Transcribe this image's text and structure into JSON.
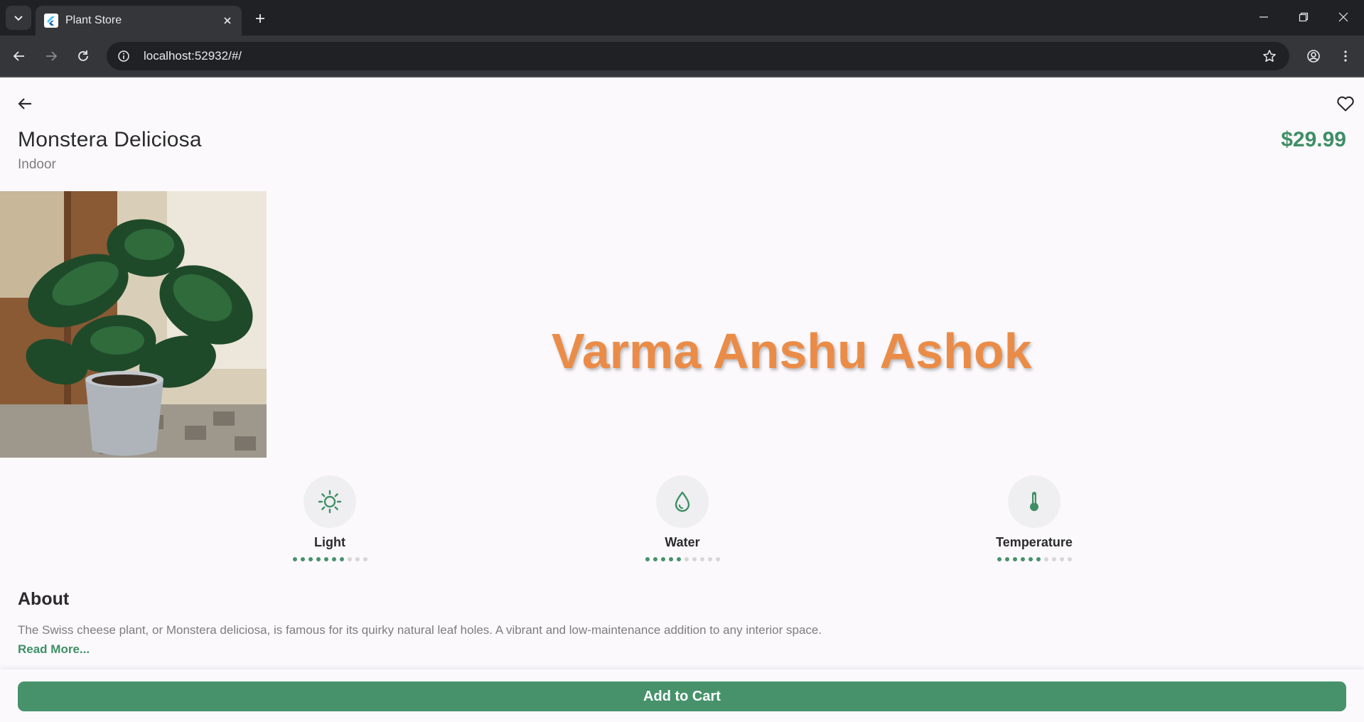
{
  "browser": {
    "tab_title": "Plant Store",
    "url": "localhost:52932/#/"
  },
  "product": {
    "name": "Monstera Deliciosa",
    "category": "Indoor",
    "price": "$29.99",
    "image_label": "Monstera plant in speckled pot",
    "watermark": "Varma Anshu Ashok"
  },
  "care": [
    {
      "label": "Light",
      "icon": "sun-icon",
      "level": 7,
      "max": 10
    },
    {
      "label": "Water",
      "icon": "water-drop-icon",
      "level": 5,
      "max": 10
    },
    {
      "label": "Temperature",
      "icon": "thermometer-icon",
      "level": 6,
      "max": 10
    }
  ],
  "about": {
    "heading": "About",
    "text": "The Swiss cheese plant, or Monstera deliciosa, is famous for its quirky natural leaf holes. A vibrant and low-maintenance addition to any interior space.",
    "read_more": "Read More..."
  },
  "cta": {
    "label": "Add to Cart"
  },
  "colors": {
    "accent": "#47926b",
    "price": "#3f8f66",
    "watermark": "#ea8c47",
    "dot_inactive": "#d6d6d6"
  }
}
